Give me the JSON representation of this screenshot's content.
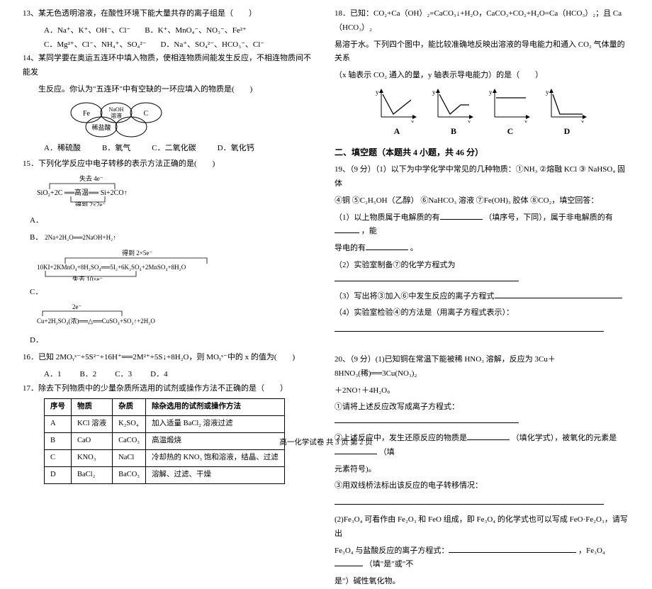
{
  "left": {
    "q13": {
      "stem": "13、某无色透明溶液，在酸性环境下能大量共存的离子组是（　　）",
      "optA": "A．Na⁺、K⁺、OH⁻、Cl⁻",
      "optB": "B．K⁺、MnO₄⁻、NO₃⁻、Fe²⁺",
      "optC": "C．Mg²⁺、Cl⁻、NH₄⁺、SO₄²⁻",
      "optD": "D．Na⁺、SO₄²⁻、HCO₃⁻、Cl⁻"
    },
    "q14": {
      "stem1": "14、某同学要在奥运五连环中填入物质，使相连物质间能发生反应，不相连物质间不能发",
      "stem2": "生反应。你认为\"五连环\"中有空缺的一环应填入的物质是(　　)",
      "rings": {
        "r1": "Fe",
        "r2_top": "NaOH",
        "r2_bot": "溶液",
        "r3": "",
        "r4": "C",
        "bottom": "稀盐酸"
      },
      "optA": "A．稀硫酸",
      "optB": "B．氧气",
      "optC": "C．二氧化碳",
      "optD": "D．氧化钙"
    },
    "q15": {
      "stem": "15．下列化学反应中电子转移的表示方法正确的是(　　)",
      "eqA_top": "失去 4e⁻",
      "eqA": "SiO₂+2C ══高温══ Si+2CO↑",
      "eqA_bot": "得到 2×2e⁻",
      "labelA": "A．",
      "eqB": "2Na+2H₂O══2NaOH+H₂↑",
      "labelB": "B．",
      "eqC_top": "得到 2×5e⁻",
      "eqC": "10KI+2KMnO₄+8H₂SO₄══5I₂+6K₂SO₄+2MnSO₄+8H₂O",
      "eqC_bot": "失去 10×e⁻",
      "labelC": "C．",
      "eqD_top": "2e⁻",
      "eqD": "Cu+2H₂SO₄(浓)══△══CuSO₄+SO₂↑+2H₂O",
      "labelD": "D．"
    },
    "q16": {
      "stem": "16．已知 2MOᵧˣ⁻+5S²⁻+16H⁺══2M²⁺+5S↓+8H₂O，则 MOᵧˣ⁻中的 x 的值为(　　)",
      "optA": "A．1",
      "optB": "B．2",
      "optC": "C．3",
      "optD": "D．4"
    },
    "q17": {
      "stem": "17．除去下列物质中的少量杂质所选用的试剂或操作方法不正确的是（　　）",
      "th1": "序号",
      "th2": "物质",
      "th3": "杂质",
      "th4": "除杂选用的试剂或操作方法",
      "rows": [
        {
          "c1": "A",
          "c2": "KCl 溶液",
          "c3": "K₂SO₄",
          "c4": "加入适量 BaCl₂ 溶液过滤"
        },
        {
          "c1": "B",
          "c2": "CaO",
          "c3": "CaCO₃",
          "c4": "高温煅烧"
        },
        {
          "c1": "C",
          "c2": "KNO₃",
          "c3": "NaCl",
          "c4": "冷却热的 KNO₃ 饱和溶液，结晶、过滤"
        },
        {
          "c1": "D",
          "c2": "BaCl₂",
          "c3": "BaCO₃",
          "c4": "溶解、过滤、干燥"
        }
      ]
    }
  },
  "right": {
    "q18": {
      "stem1": "18．已知：CO₂+Ca（OH）₂=CaCO₃↓+H₂O，CaCO₃+CO₂+H₂O=Ca（HCO₃）₂；且 Ca（HCO₃）₂",
      "stem2": "易溶于水。下列四个图中，能比较准确地反映出溶液的导电能力和通入 CO₂ 气体量的关系",
      "stem3": "（x 轴表示 CO₂ 通入的量，y 轴表示导电能力）的是（　　）",
      "labels": {
        "a": "A",
        "b": "B",
        "c": "C",
        "d": "D"
      }
    },
    "section2": "二、填空题（本题共 4 小题，共 46 分）",
    "q19": {
      "stem1": "19、（9 分）（1）以下为中学化学中常见的几种物质：①NH₃ ②熔融 KCl ③ NaHSO₄ 固体",
      "stem2": "④铜 ⑤C₂H₅OH（乙醇） ⑥NaHCO₃ 溶液 ⑦Fe(OH)₃ 胶体 ⑧CO₂，填空回答：",
      "sub1a": "（1）以上物质属于电解质的有",
      "sub1b": "（填序号，下同），属于非电解质的有",
      "sub1c": "，能",
      "sub1d": "导电的有",
      "sub1e": "。",
      "sub2a": "（2）实验室制备⑦的化学方程式为",
      "sub2b": "",
      "sub3a": "（3）写出将③加入⑥中发生反应的离子方程式",
      "sub4a": "（4）实验室检验④的方法是（用离子方程式表示）："
    },
    "q20": {
      "stem1": "20、（9 分）(1)已知铜在常温下能被稀 HNO₃ 溶解，反应为 3Cu＋8HNO₃(稀)══3Cu(NO₃)₂",
      "stem2": "＋2NO↑＋4H₂O。",
      "sub1": "①请将上述反应改写成离子方程式：",
      "sub2a": "②上述反应中，发生还原反应的物质是",
      "sub2b": "（填化学式），被氧化的元素是",
      "sub2c": "（填",
      "sub2d": "元素符号)。",
      "sub3": "③用双线桥法标出该反应的电子转移情况：",
      "sub4a": "(2)Fe₃O₄ 可看作由 Fe₂O₃ 和 FeO 组成，即 Fe₃O₄ 的化学式也可以写成 FeO·Fe₂O₃，请写出",
      "sub4b": "Fe₃O₄ 与盐酸反应的离子方程式：",
      "sub4c": "，Fe₃O₄",
      "sub4d": "（填\"是\"或\"不",
      "sub4e": "是\"）碱性氧化物。"
    }
  },
  "footer": "高一化学试卷  共 3 页  第 2 页"
}
